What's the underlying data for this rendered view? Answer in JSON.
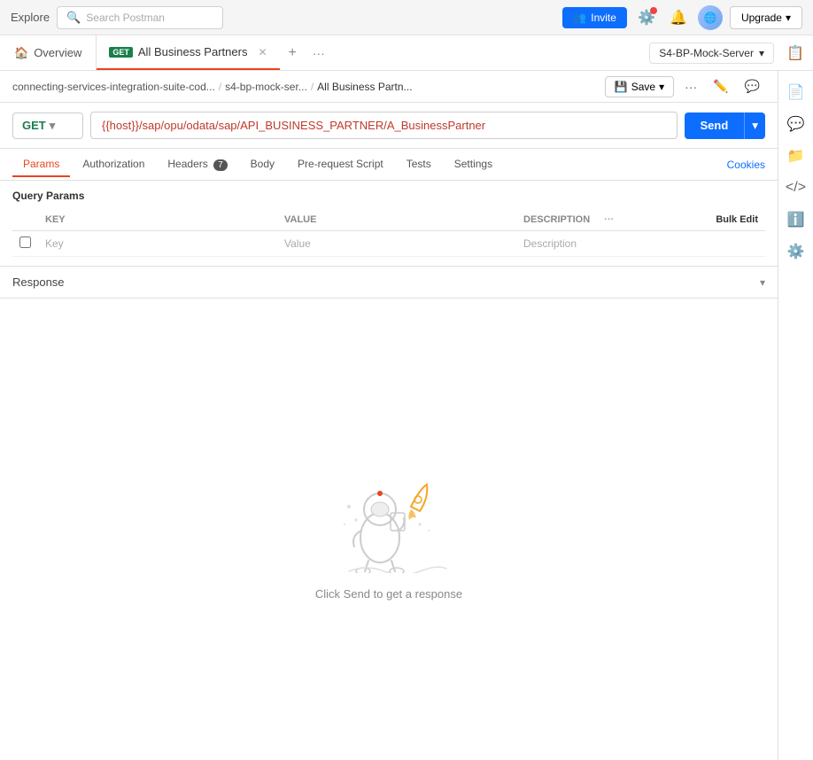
{
  "app": {
    "title": "Explore"
  },
  "topbar": {
    "explore_label": "Explore",
    "search_placeholder": "Search Postman",
    "invite_label": "Invite",
    "upgrade_label": "Upgrade"
  },
  "tabs": {
    "overview_label": "Overview",
    "active_tab_method": "GET",
    "active_tab_name": "All Business Partners",
    "add_icon": "+",
    "more_icon": "···"
  },
  "server": {
    "name": "S4-BP-Mock-Server"
  },
  "breadcrumb": {
    "part1": "connecting-services-integration-suite-cod...",
    "sep1": "/",
    "part2": "s4-bp-mock-ser...",
    "sep2": "/",
    "part3": "All Business Partn...",
    "save_label": "Save",
    "more_label": "···"
  },
  "request": {
    "method": "GET",
    "url": "{{host}}/sap/opu/odata/sap/API_BUSINESS_PARTNER/A_BusinessPartner",
    "send_label": "Send"
  },
  "request_tabs": {
    "params": "Params",
    "authorization": "Authorization",
    "headers": "Headers",
    "headers_count": "7",
    "body": "Body",
    "pre_request": "Pre-request Script",
    "tests": "Tests",
    "settings": "Settings",
    "cookies": "Cookies"
  },
  "params": {
    "section_title": "Query Params",
    "col_key": "KEY",
    "col_value": "VALUE",
    "col_description": "DESCRIPTION",
    "bulk_edit": "Bulk Edit",
    "placeholder_key": "Key",
    "placeholder_value": "Value",
    "placeholder_desc": "Description"
  },
  "response": {
    "label": "Response",
    "empty_text": "Click Send to get a response"
  },
  "right_panel": {
    "icons": [
      "doc",
      "comment",
      "file",
      "reply",
      "info",
      "settings"
    ]
  }
}
